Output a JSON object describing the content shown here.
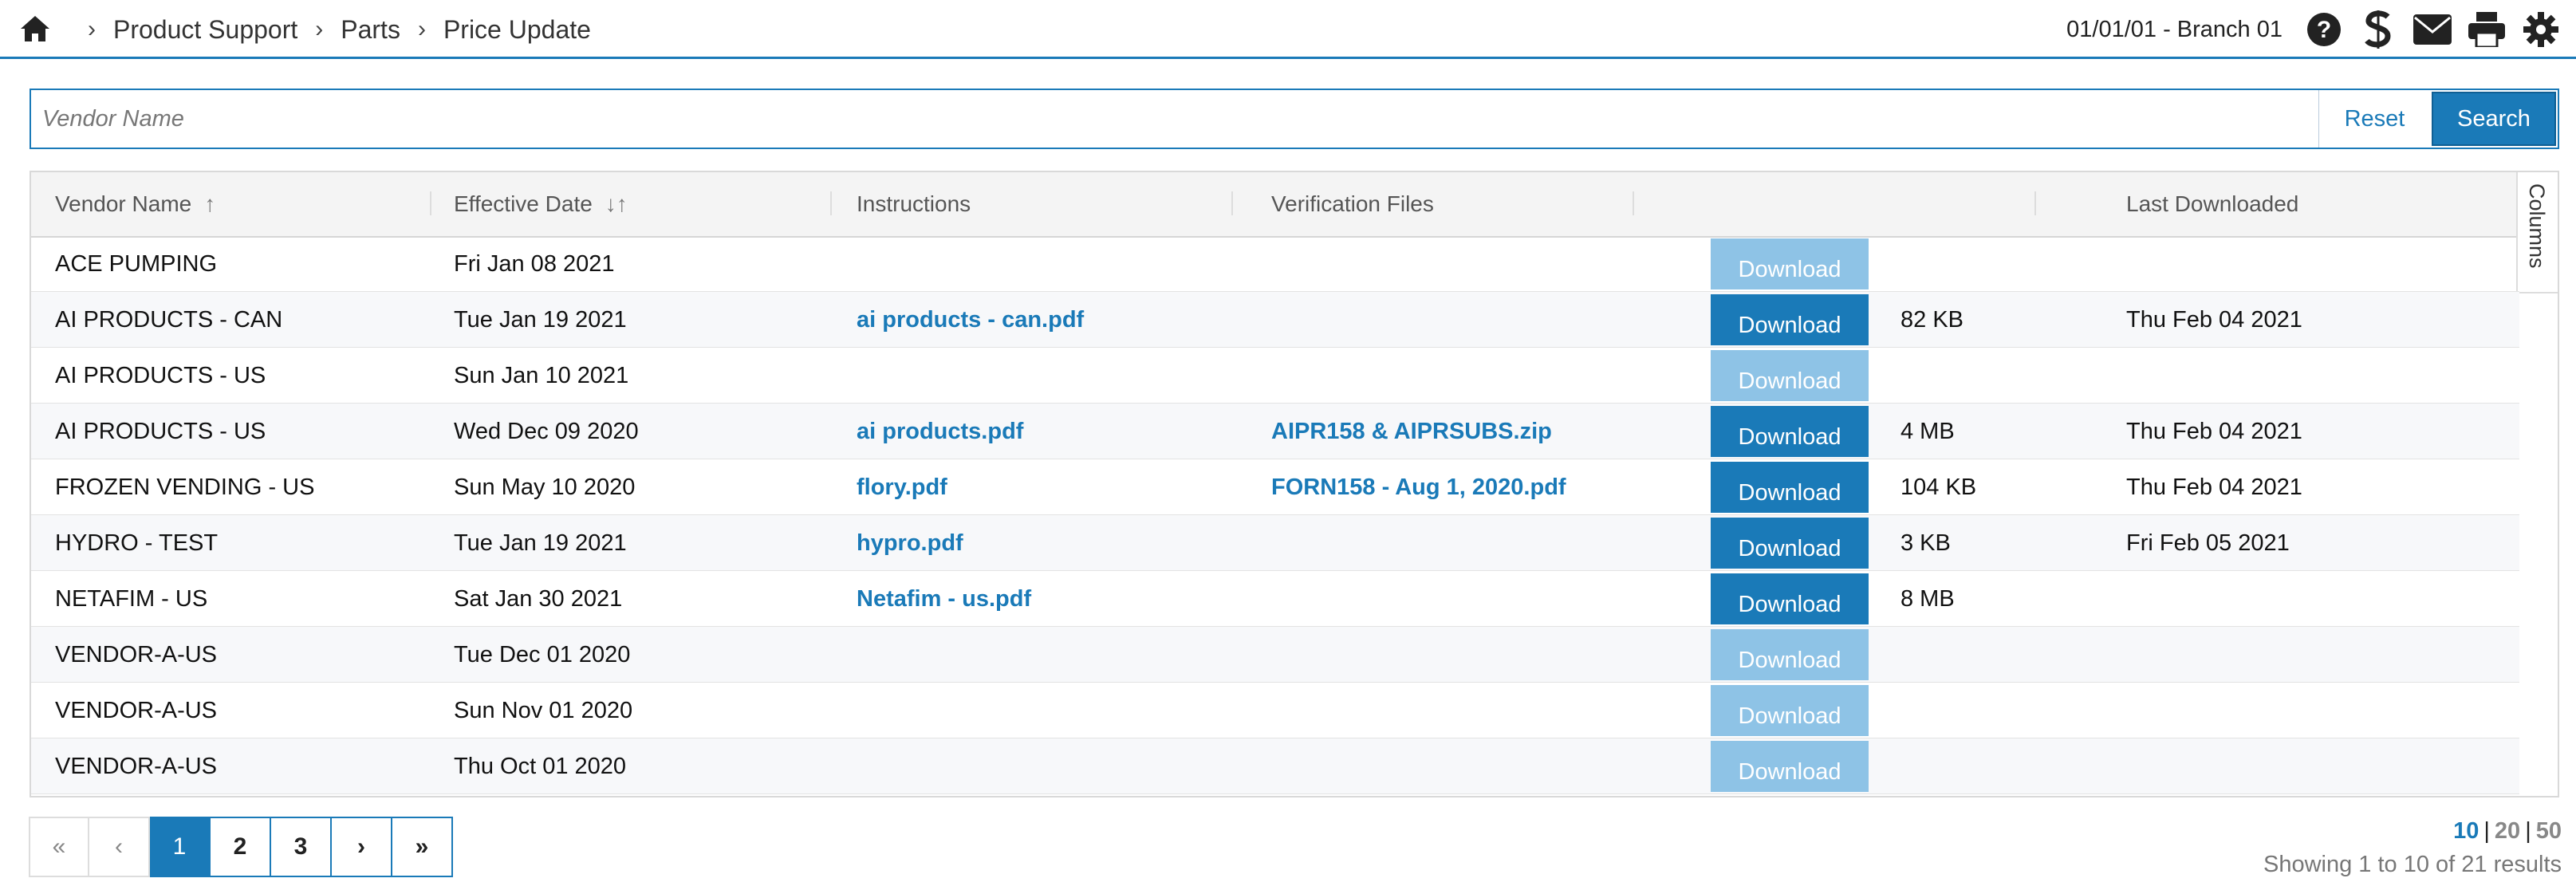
{
  "breadcrumbs": [
    "Product Support",
    "Parts",
    "Price Update"
  ],
  "branch": "01/01/01 - Branch 01",
  "header_icons": [
    "help-icon",
    "s-logo-icon",
    "mail-icon",
    "print-icon",
    "gear-icon"
  ],
  "search": {
    "placeholder": "Vendor Name",
    "reset_label": "Reset",
    "search_label": "Search"
  },
  "columns": {
    "vendor": "Vendor Name",
    "effective": "Effective Date",
    "instructions": "Instructions",
    "files": "Verification Files",
    "download": "",
    "last": "Last Downloaded",
    "tab": "Columns",
    "vendor_sort": "↑",
    "effective_sort": "↓↑"
  },
  "rows": [
    {
      "vendor": "ACE PUMPING",
      "date": "Fri Jan 08 2021",
      "instructions": "",
      "files": "",
      "download": "Download",
      "enabled": false,
      "size": "",
      "last": ""
    },
    {
      "vendor": "AI PRODUCTS - CAN",
      "date": "Tue Jan 19 2021",
      "instructions": "ai products - can.pdf",
      "files": "",
      "download": "Download",
      "enabled": true,
      "size": "82 KB",
      "last": "Thu Feb 04 2021"
    },
    {
      "vendor": "AI PRODUCTS - US",
      "date": "Sun Jan 10 2021",
      "instructions": "",
      "files": "",
      "download": "Download",
      "enabled": false,
      "size": "",
      "last": ""
    },
    {
      "vendor": "AI PRODUCTS - US",
      "date": "Wed Dec 09 2020",
      "instructions": "ai products.pdf",
      "files": "AIPR158 & AIPRSUBS.zip",
      "download": "Download",
      "enabled": true,
      "size": "4 MB",
      "last": "Thu Feb 04 2021"
    },
    {
      "vendor": "FROZEN VENDING - US",
      "date": "Sun May 10 2020",
      "instructions": "flory.pdf",
      "files": "FORN158 - Aug 1, 2020.pdf",
      "download": "Download",
      "enabled": true,
      "size": "104 KB",
      "last": "Thu Feb 04 2021"
    },
    {
      "vendor": "HYDRO - TEST",
      "date": "Tue Jan 19 2021",
      "instructions": "hypro.pdf",
      "files": "",
      "download": "Download",
      "enabled": true,
      "size": "3 KB",
      "last": "Fri Feb 05 2021"
    },
    {
      "vendor": "NETAFIM - US",
      "date": "Sat Jan 30 2021",
      "instructions": "Netafim - us.pdf",
      "files": "",
      "download": "Download",
      "enabled": true,
      "size": "8 MB",
      "last": ""
    },
    {
      "vendor": "VENDOR-A-US",
      "date": "Tue Dec 01 2020",
      "instructions": "",
      "files": "",
      "download": "Download",
      "enabled": false,
      "size": "",
      "last": ""
    },
    {
      "vendor": "VENDOR-A-US",
      "date": "Sun Nov 01 2020",
      "instructions": "",
      "files": "",
      "download": "Download",
      "enabled": false,
      "size": "",
      "last": ""
    },
    {
      "vendor": "VENDOR-A-US",
      "date": "Thu Oct 01 2020",
      "instructions": "",
      "files": "",
      "download": "Download",
      "enabled": false,
      "size": "",
      "last": ""
    }
  ],
  "pagination": {
    "first": "«",
    "prev": "‹",
    "pages": [
      "1",
      "2",
      "3"
    ],
    "current": "1",
    "next": "›",
    "last": "»"
  },
  "page_sizes": {
    "sizes": [
      "10",
      "20",
      "50"
    ],
    "current": "10",
    "separator": "|"
  },
  "summary": "Showing 1 to 10 of 21 results",
  "colors": {
    "accent": "#1a7ab8",
    "disabled_button": "#8ec3e6"
  }
}
